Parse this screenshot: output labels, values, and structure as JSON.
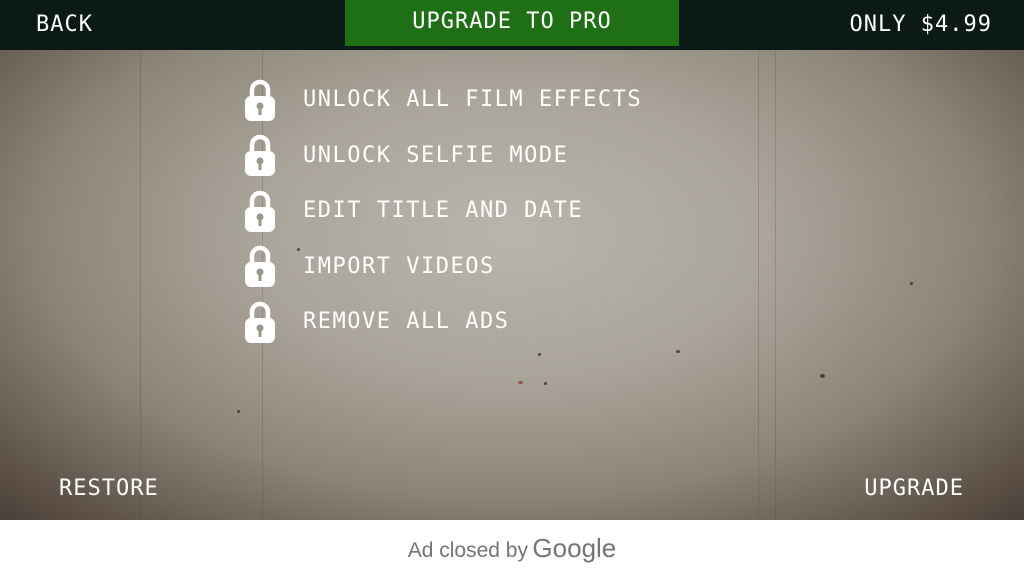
{
  "header": {
    "back_label": "BACK",
    "title": "UPGRADE TO PRO",
    "price": "ONLY $4.99"
  },
  "features": [
    {
      "label": "UNLOCK ALL FILM EFFECTS",
      "icon": "lock-icon"
    },
    {
      "label": "UNLOCK SELFIE MODE",
      "icon": "lock-icon"
    },
    {
      "label": "EDIT TITLE AND DATE",
      "icon": "lock-icon"
    },
    {
      "label": "IMPORT VIDEOS",
      "icon": "lock-icon"
    },
    {
      "label": "REMOVE ALL ADS",
      "icon": "lock-icon"
    }
  ],
  "footer": {
    "restore_label": "RESTORE",
    "upgrade_label": "UPGRADE"
  },
  "ad": {
    "closed_text": "Ad closed by",
    "brand": "Google"
  },
  "colors": {
    "topbar": "#0b1a16",
    "title_box": "#1f6f16",
    "text": "#ffffff",
    "ad_bar": "#ffffff"
  }
}
